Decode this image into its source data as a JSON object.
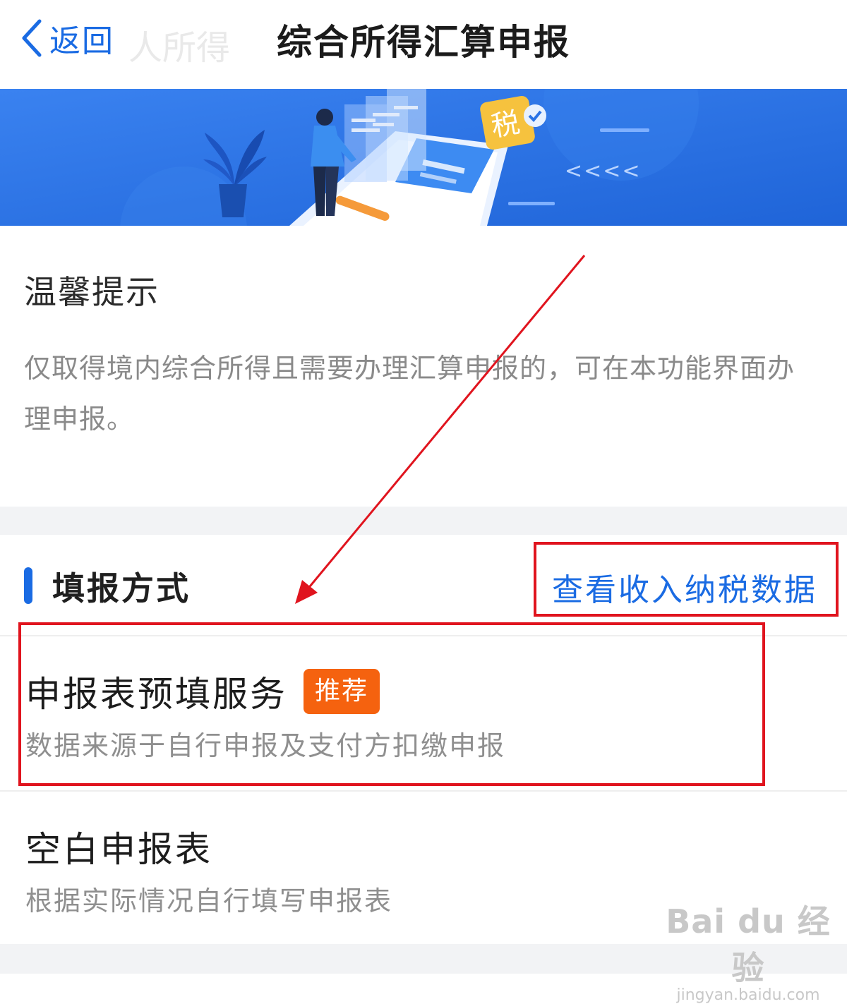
{
  "navbar": {
    "back_label": "返回",
    "title": "综合所得汇算申报",
    "ghost_text": "人所得"
  },
  "tips": {
    "title": "温馨提示",
    "body": "仅取得境内综合所得且需要办理汇算申报的，可在本功能界面办理申报。"
  },
  "method": {
    "title": "填报方式",
    "income_link": "查看收入纳税数据",
    "options": [
      {
        "title": "申报表预填服务",
        "badge": "推荐",
        "desc": "数据来源于自行申报及支付方扣缴申报"
      },
      {
        "title": "空白申报表",
        "desc": "根据实际情况自行填写申报表"
      }
    ]
  },
  "banner": {
    "tax_badge": "税",
    "chevrons": "<<<<",
    "colors": {
      "background": "#2a73e6",
      "badge": "#f6c23e"
    }
  },
  "watermark": {
    "main": "Bai du 经验",
    "sub": "jingyan.baidu.com"
  },
  "colors": {
    "accent": "#1a6be3",
    "badge": "#f5620f",
    "annotation": "#e0141e"
  }
}
